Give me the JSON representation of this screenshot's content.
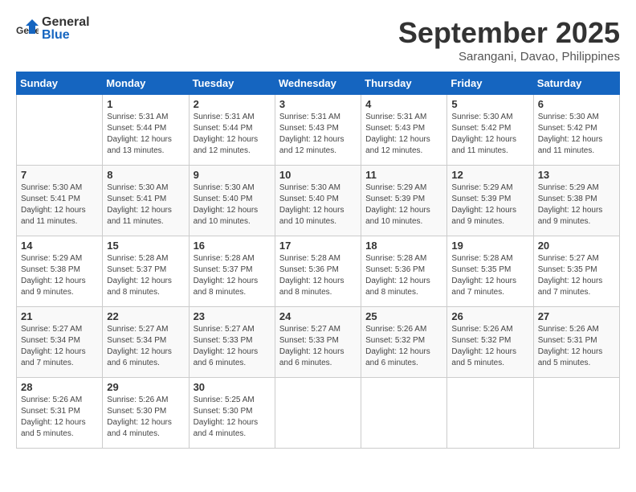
{
  "header": {
    "logo_general": "General",
    "logo_blue": "Blue",
    "month_title": "September 2025",
    "subtitle": "Sarangani, Davao, Philippines"
  },
  "days_of_week": [
    "Sunday",
    "Monday",
    "Tuesday",
    "Wednesday",
    "Thursday",
    "Friday",
    "Saturday"
  ],
  "weeks": [
    [
      {
        "num": "",
        "detail": ""
      },
      {
        "num": "1",
        "detail": "Sunrise: 5:31 AM\nSunset: 5:44 PM\nDaylight: 12 hours\nand 13 minutes."
      },
      {
        "num": "2",
        "detail": "Sunrise: 5:31 AM\nSunset: 5:44 PM\nDaylight: 12 hours\nand 12 minutes."
      },
      {
        "num": "3",
        "detail": "Sunrise: 5:31 AM\nSunset: 5:43 PM\nDaylight: 12 hours\nand 12 minutes."
      },
      {
        "num": "4",
        "detail": "Sunrise: 5:31 AM\nSunset: 5:43 PM\nDaylight: 12 hours\nand 12 minutes."
      },
      {
        "num": "5",
        "detail": "Sunrise: 5:30 AM\nSunset: 5:42 PM\nDaylight: 12 hours\nand 11 minutes."
      },
      {
        "num": "6",
        "detail": "Sunrise: 5:30 AM\nSunset: 5:42 PM\nDaylight: 12 hours\nand 11 minutes."
      }
    ],
    [
      {
        "num": "7",
        "detail": "Sunrise: 5:30 AM\nSunset: 5:41 PM\nDaylight: 12 hours\nand 11 minutes."
      },
      {
        "num": "8",
        "detail": "Sunrise: 5:30 AM\nSunset: 5:41 PM\nDaylight: 12 hours\nand 11 minutes."
      },
      {
        "num": "9",
        "detail": "Sunrise: 5:30 AM\nSunset: 5:40 PM\nDaylight: 12 hours\nand 10 minutes."
      },
      {
        "num": "10",
        "detail": "Sunrise: 5:30 AM\nSunset: 5:40 PM\nDaylight: 12 hours\nand 10 minutes."
      },
      {
        "num": "11",
        "detail": "Sunrise: 5:29 AM\nSunset: 5:39 PM\nDaylight: 12 hours\nand 10 minutes."
      },
      {
        "num": "12",
        "detail": "Sunrise: 5:29 AM\nSunset: 5:39 PM\nDaylight: 12 hours\nand 9 minutes."
      },
      {
        "num": "13",
        "detail": "Sunrise: 5:29 AM\nSunset: 5:38 PM\nDaylight: 12 hours\nand 9 minutes."
      }
    ],
    [
      {
        "num": "14",
        "detail": "Sunrise: 5:29 AM\nSunset: 5:38 PM\nDaylight: 12 hours\nand 9 minutes."
      },
      {
        "num": "15",
        "detail": "Sunrise: 5:28 AM\nSunset: 5:37 PM\nDaylight: 12 hours\nand 8 minutes."
      },
      {
        "num": "16",
        "detail": "Sunrise: 5:28 AM\nSunset: 5:37 PM\nDaylight: 12 hours\nand 8 minutes."
      },
      {
        "num": "17",
        "detail": "Sunrise: 5:28 AM\nSunset: 5:36 PM\nDaylight: 12 hours\nand 8 minutes."
      },
      {
        "num": "18",
        "detail": "Sunrise: 5:28 AM\nSunset: 5:36 PM\nDaylight: 12 hours\nand 8 minutes."
      },
      {
        "num": "19",
        "detail": "Sunrise: 5:28 AM\nSunset: 5:35 PM\nDaylight: 12 hours\nand 7 minutes."
      },
      {
        "num": "20",
        "detail": "Sunrise: 5:27 AM\nSunset: 5:35 PM\nDaylight: 12 hours\nand 7 minutes."
      }
    ],
    [
      {
        "num": "21",
        "detail": "Sunrise: 5:27 AM\nSunset: 5:34 PM\nDaylight: 12 hours\nand 7 minutes."
      },
      {
        "num": "22",
        "detail": "Sunrise: 5:27 AM\nSunset: 5:34 PM\nDaylight: 12 hours\nand 6 minutes."
      },
      {
        "num": "23",
        "detail": "Sunrise: 5:27 AM\nSunset: 5:33 PM\nDaylight: 12 hours\nand 6 minutes."
      },
      {
        "num": "24",
        "detail": "Sunrise: 5:27 AM\nSunset: 5:33 PM\nDaylight: 12 hours\nand 6 minutes."
      },
      {
        "num": "25",
        "detail": "Sunrise: 5:26 AM\nSunset: 5:32 PM\nDaylight: 12 hours\nand 6 minutes."
      },
      {
        "num": "26",
        "detail": "Sunrise: 5:26 AM\nSunset: 5:32 PM\nDaylight: 12 hours\nand 5 minutes."
      },
      {
        "num": "27",
        "detail": "Sunrise: 5:26 AM\nSunset: 5:31 PM\nDaylight: 12 hours\nand 5 minutes."
      }
    ],
    [
      {
        "num": "28",
        "detail": "Sunrise: 5:26 AM\nSunset: 5:31 PM\nDaylight: 12 hours\nand 5 minutes."
      },
      {
        "num": "29",
        "detail": "Sunrise: 5:26 AM\nSunset: 5:30 PM\nDaylight: 12 hours\nand 4 minutes."
      },
      {
        "num": "30",
        "detail": "Sunrise: 5:25 AM\nSunset: 5:30 PM\nDaylight: 12 hours\nand 4 minutes."
      },
      {
        "num": "",
        "detail": ""
      },
      {
        "num": "",
        "detail": ""
      },
      {
        "num": "",
        "detail": ""
      },
      {
        "num": "",
        "detail": ""
      }
    ]
  ]
}
